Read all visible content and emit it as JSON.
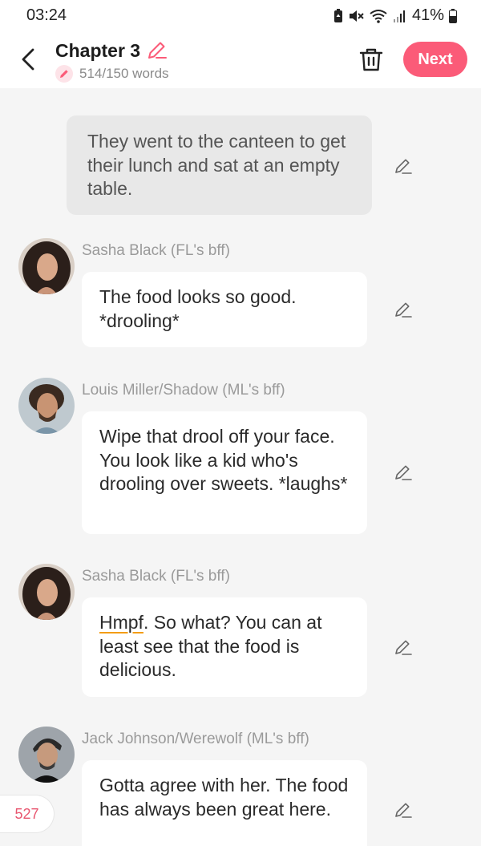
{
  "status_bar": {
    "time": "03:24",
    "battery": "41%",
    "icons": [
      "battery-saver-icon",
      "mute-icon",
      "wifi-icon",
      "signal-icon",
      "battery-icon"
    ]
  },
  "header": {
    "title": "Chapter 3",
    "word_count": "514/150 words",
    "next_label": "Next",
    "accent_color": "#fb5b78"
  },
  "narration": {
    "text": "They went to the canteen to get their lunch and sat at an empty table."
  },
  "messages": [
    {
      "speaker": "Sasha Black (FL's bff)",
      "text": "The food looks so good. *drooling*"
    },
    {
      "speaker": "Louis Miller/Shadow (ML's bff)",
      "text": "Wipe that drool off your face. You look like a kid who's drooling over sweets. *laughs*"
    },
    {
      "speaker": "Sasha Black (FL's bff)",
      "text_before": "Hmpf",
      "text_after": ". So what? You can at least see that the food is delicious."
    },
    {
      "speaker": "Jack Johnson/Werewolf (ML's bff)",
      "text": "Gotta agree with her. The food has always been great here."
    }
  ],
  "counter": "527"
}
